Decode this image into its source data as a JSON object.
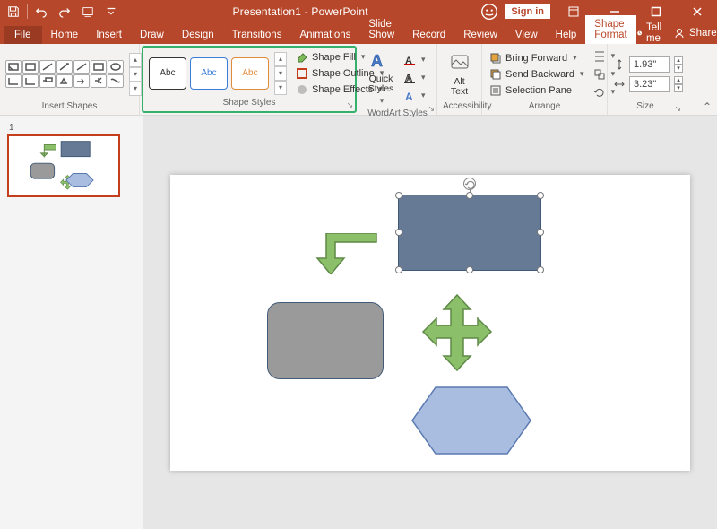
{
  "titlebar": {
    "title": "Presentation1 - PowerPoint",
    "signin": "Sign in"
  },
  "tabs": {
    "file": "File",
    "items": [
      "Home",
      "Insert",
      "Draw",
      "Design",
      "Transitions",
      "Animations",
      "Slide Show",
      "Record",
      "Review",
      "View",
      "Help"
    ],
    "active": "Shape Format",
    "tellme": "Tell me",
    "share": "Share"
  },
  "ribbon": {
    "insert_shapes": {
      "label": "Insert Shapes"
    },
    "shape_styles": {
      "label": "Shape Styles",
      "swatch": "Abc",
      "fill": "Shape Fill",
      "outline": "Shape Outline",
      "effects": "Shape Effects"
    },
    "wordart": {
      "label": "WordArt Styles",
      "quick": "Quick\nStyles"
    },
    "access": {
      "label": "Accessibility",
      "alt": "Alt\nText"
    },
    "arrange": {
      "label": "Arrange",
      "forward": "Bring Forward",
      "backward": "Send Backward",
      "pane": "Selection Pane"
    },
    "size": {
      "label": "Size",
      "h": "1.93\"",
      "w": "3.23\""
    }
  },
  "thumbs": {
    "slide1": "1"
  }
}
